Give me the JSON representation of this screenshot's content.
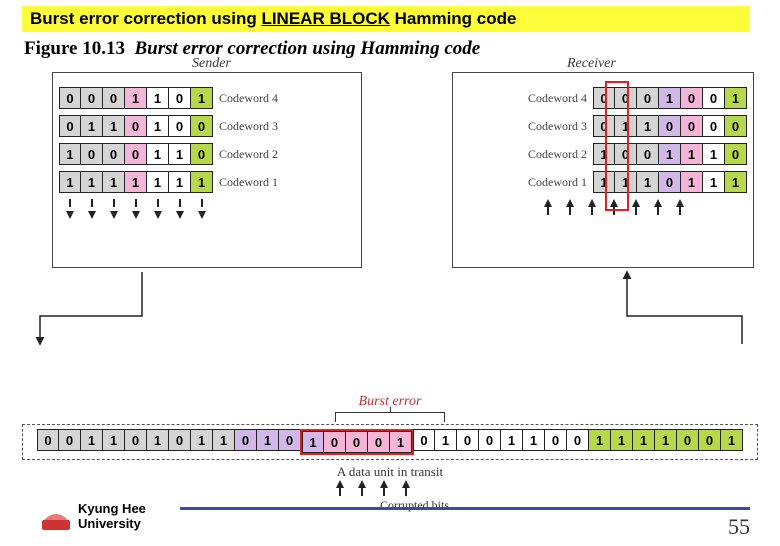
{
  "title": {
    "pre": "Burst error correction using ",
    "linear_block": "LINEAR BLOCK",
    "post": " Hamming code"
  },
  "figure": {
    "num": "Figure 10.13",
    "caption": "Burst error correction using Hamming code"
  },
  "labels": {
    "sender": "Sender",
    "receiver": "Receiver",
    "burst_error": "Burst error",
    "data_unit": "A data unit in transit",
    "corrupted_bits": "Corrupted bits"
  },
  "sender": {
    "codewords": [
      {
        "label": "Codeword 4",
        "bits": [
          "0",
          "0",
          "0",
          "1",
          "1",
          "0",
          "1"
        ],
        "colors": [
          "gray",
          "gray",
          "gray",
          "pink",
          "white",
          "white",
          "green"
        ]
      },
      {
        "label": "Codeword 3",
        "bits": [
          "0",
          "1",
          "1",
          "0",
          "1",
          "0",
          "0"
        ],
        "colors": [
          "gray",
          "gray",
          "gray",
          "pink",
          "white",
          "white",
          "green"
        ]
      },
      {
        "label": "Codeword 2",
        "bits": [
          "1",
          "0",
          "0",
          "0",
          "1",
          "1",
          "0"
        ],
        "colors": [
          "gray",
          "gray",
          "gray",
          "pink",
          "white",
          "white",
          "green"
        ]
      },
      {
        "label": "Codeword 1",
        "bits": [
          "1",
          "1",
          "1",
          "1",
          "1",
          "1",
          "1"
        ],
        "colors": [
          "gray",
          "gray",
          "gray",
          "pink",
          "white",
          "white",
          "green"
        ]
      }
    ]
  },
  "receiver": {
    "codewords": [
      {
        "label": "Codeword 4",
        "bits": [
          "0",
          "0",
          "0",
          "1",
          "0",
          "0",
          "1"
        ],
        "colors": [
          "gray",
          "gray",
          "gray",
          "purple",
          "pink",
          "white",
          "green"
        ]
      },
      {
        "label": "Codeword 3",
        "bits": [
          "0",
          "1",
          "1",
          "0",
          "0",
          "0",
          "0"
        ],
        "colors": [
          "gray",
          "gray",
          "gray",
          "purple",
          "pink",
          "white",
          "green"
        ]
      },
      {
        "label": "Codeword 2",
        "bits": [
          "1",
          "0",
          "0",
          "1",
          "1",
          "1",
          "0"
        ],
        "colors": [
          "gray",
          "gray",
          "gray",
          "purple",
          "pink",
          "white",
          "green"
        ]
      },
      {
        "label": "Codeword 1",
        "bits": [
          "1",
          "1",
          "1",
          "0",
          "1",
          "1",
          "1"
        ],
        "colors": [
          "gray",
          "gray",
          "gray",
          "purple",
          "pink",
          "white",
          "green"
        ]
      }
    ]
  },
  "data_unit": {
    "bits": [
      "0",
      "0",
      "1",
      "1",
      "0",
      "1",
      "0",
      "1",
      "1",
      "0",
      "1",
      "0",
      "1",
      "0",
      "0",
      "0",
      "1",
      "0",
      "1",
      "0",
      "0",
      "1",
      "1",
      "0",
      "0",
      "1",
      "1",
      "1",
      "1",
      "0",
      "0",
      "1"
    ],
    "colors": [
      "gray",
      "gray",
      "gray",
      "gray",
      "gray",
      "gray",
      "gray",
      "gray",
      "gray",
      "purple",
      "purple",
      "purple",
      "purple",
      "pink",
      "pink",
      "pink",
      "pink",
      "white",
      "white",
      "white",
      "white",
      "white",
      "white",
      "white",
      "white",
      "green",
      "green",
      "green",
      "green",
      "green",
      "green",
      "green"
    ],
    "burst_indices": [
      12,
      13,
      14,
      15,
      16
    ]
  },
  "footer": {
    "uni1": "Kyung Hee",
    "uni2": "University",
    "page": "55"
  }
}
